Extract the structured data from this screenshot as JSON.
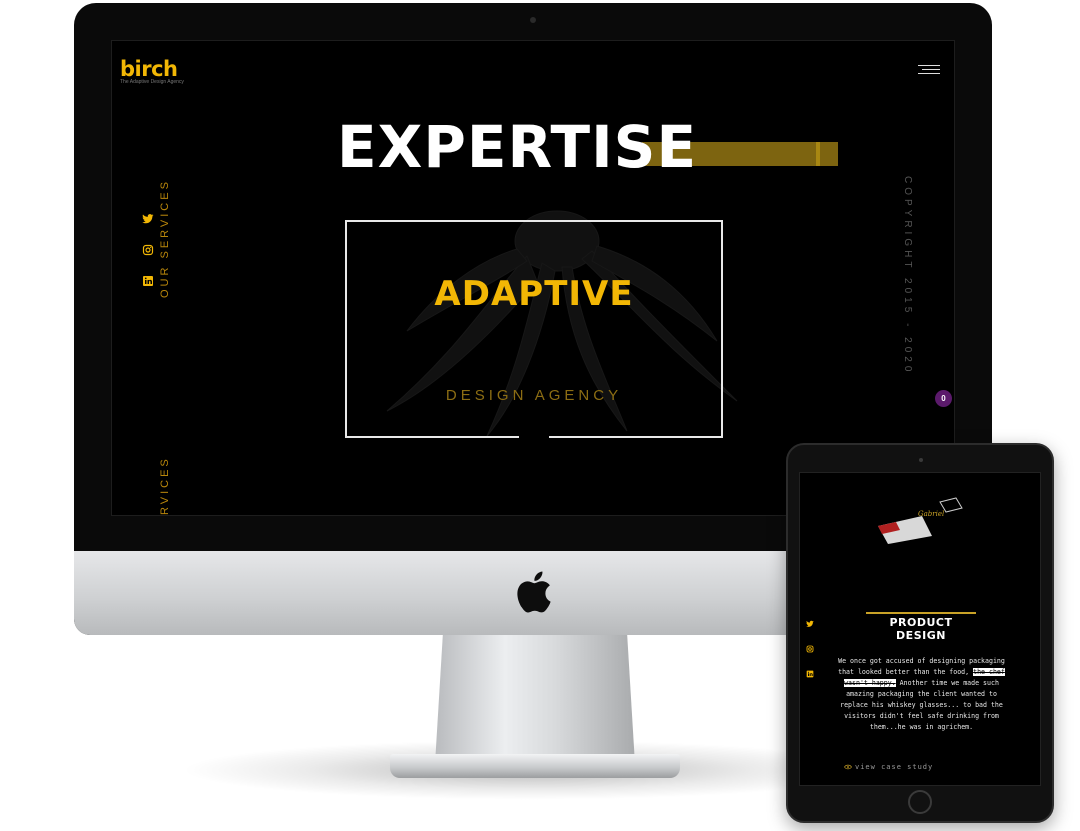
{
  "desktop_site": {
    "brand": {
      "name": "birch",
      "tagline": "The Adaptive Design Agency"
    },
    "side_label": "OUR SERVICES",
    "side_label_partial": "RVICES",
    "headline": "EXPERTISE",
    "hero": {
      "title": "ADAPTIVE",
      "subtitle": "DESIGN AGENCY"
    },
    "copyright": "COPYRIGHT 2015 - 2020",
    "badge_count": "0",
    "social_icons": [
      "twitter-icon",
      "instagram-icon",
      "linkedin-icon"
    ],
    "colors": {
      "accent": "#f2b705",
      "background": "#000000",
      "badge": "#5b1a6b"
    }
  },
  "tablet_site": {
    "section_title": "PRODUCT DESIGN",
    "body_pre": "We once got accused of designing packaging that looked better than the food,",
    "body_strike": "the chef wasn't happy.",
    "body_post": "Another time we made such amazing packaging the client wanted to replace his whiskey glasses... to bad the visitors didn't feel safe drinking from them...he was in agrichem.",
    "cta": "view case study",
    "social_icons": [
      "twitter-icon",
      "instagram-icon",
      "linkedin-icon"
    ]
  }
}
